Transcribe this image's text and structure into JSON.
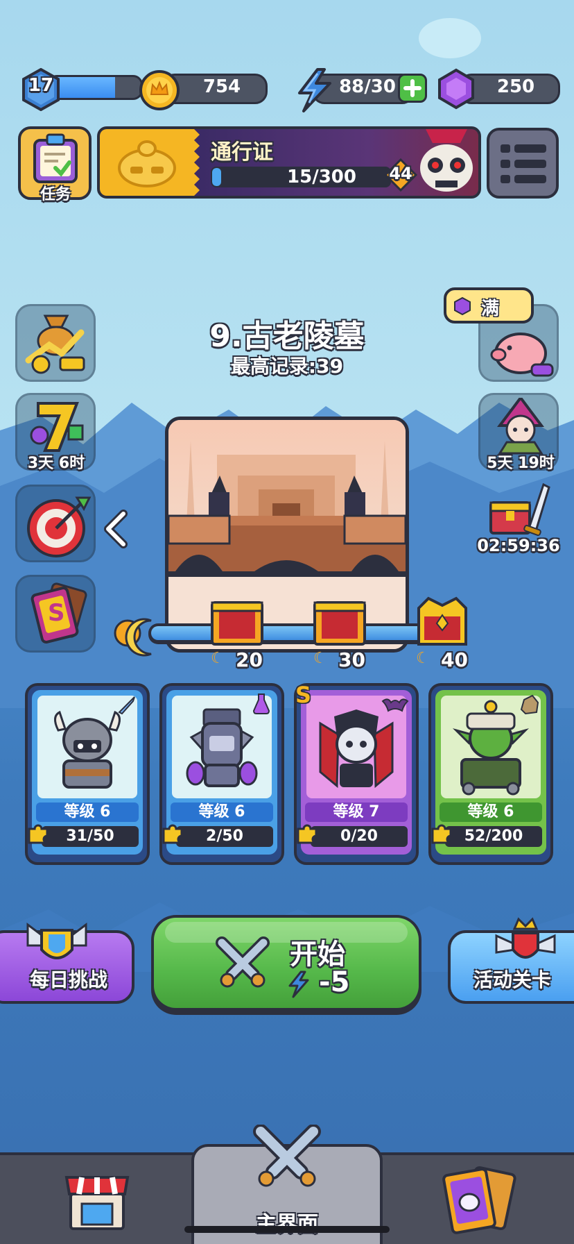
{
  "player": {
    "level": "17",
    "xp_fraction": 0.72
  },
  "resources": {
    "coins": "754",
    "energy": "88/30",
    "gems": "250"
  },
  "tasks": {
    "label": "任务"
  },
  "pass": {
    "title": "通行证",
    "progress": "15/300",
    "progress_fraction": 0.05,
    "tier": "44"
  },
  "stage": {
    "name": "9.古老陵墓",
    "best": "最高记录:39"
  },
  "piggy": {
    "label": "满"
  },
  "side_left": [
    {
      "name": "growth-fund"
    },
    {
      "name": "seven-day",
      "timer": "3天 6时"
    },
    {
      "name": "target-event"
    },
    {
      "name": "skill-card"
    }
  ],
  "side_right": [
    {
      "name": "piggy-bank"
    },
    {
      "name": "character-event",
      "timer": "5天 19时"
    },
    {
      "name": "treasure-chest",
      "timer": "02:59:36"
    }
  ],
  "milestones": [
    {
      "value": "20"
    },
    {
      "value": "30"
    },
    {
      "value": "40"
    }
  ],
  "heroes": [
    {
      "name": "viking",
      "level": "等级 6",
      "shards": "31/50",
      "rarity": "",
      "tint": "#dff3f6",
      "frame": "#4aa0e6",
      "lvlbg": "#2a74d0",
      "icon": "sword-icon"
    },
    {
      "name": "alchemist",
      "level": "等级 6",
      "shards": "2/50",
      "rarity": "",
      "tint": "#dff3f6",
      "frame": "#4aa0e6",
      "lvlbg": "#2a74d0",
      "icon": "potion-icon"
    },
    {
      "name": "vampire",
      "level": "等级 7",
      "shards": "0/20",
      "rarity": "S",
      "tint": "#e89ae8",
      "frame": "#a35fd8",
      "lvlbg": "#7d3cc0",
      "icon": "bat-icon"
    },
    {
      "name": "goblin",
      "level": "等级 6",
      "shards": "52/200",
      "rarity": "",
      "tint": "#dff0c8",
      "frame": "#74c24a",
      "lvlbg": "#3f9630",
      "icon": "rock-icon"
    }
  ],
  "buttons": {
    "daily": "每日挑战",
    "start": "开始",
    "start_cost": "-5",
    "event": "活动关卡"
  },
  "nav": {
    "shop": "",
    "main": "主界面",
    "cards": ""
  },
  "colors": {
    "accent_green": "#55b84a",
    "gold": "#f5b623",
    "purple": "#9b4fe0",
    "blue": "#3e88dd"
  }
}
